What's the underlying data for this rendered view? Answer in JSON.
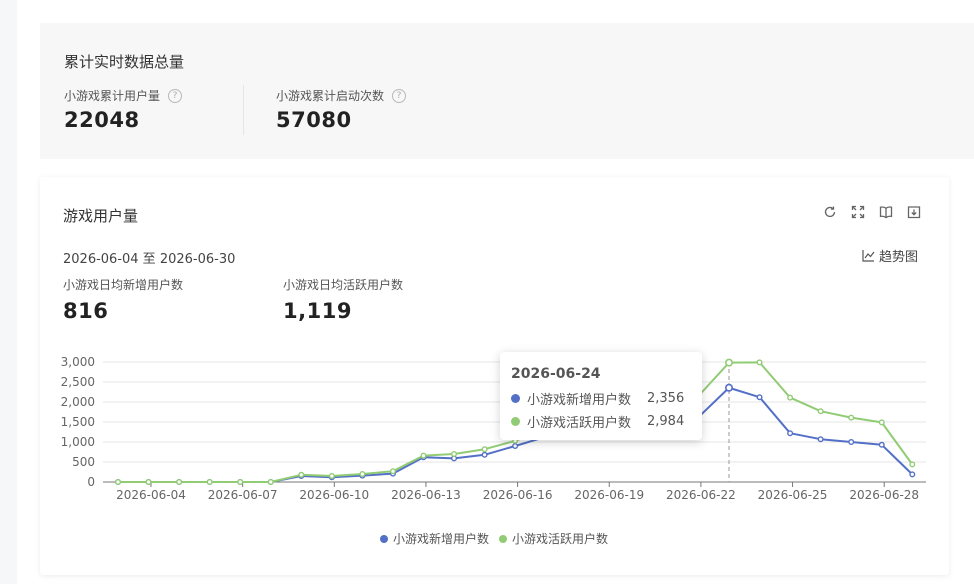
{
  "summary": {
    "title": "累计实时数据总量",
    "metrics": [
      {
        "label": "小游戏累计用户量",
        "value": "22048"
      },
      {
        "label": "小游戏累计启动次数",
        "value": "57080"
      }
    ]
  },
  "card": {
    "title": "游戏用户量",
    "date_range": "2026-06-04 至 2026-06-30",
    "trend_label": "趋势图",
    "toolbar_icons": [
      "refresh-icon",
      "fullscreen-icon",
      "book-icon",
      "download-icon"
    ],
    "kpis": [
      {
        "label": "小游戏日均新增用户数",
        "value": "816"
      },
      {
        "label": "小游戏日均活跃用户数",
        "value": "1,119"
      }
    ]
  },
  "tooltip": {
    "date": "2026-06-24",
    "rows": [
      {
        "label": "小游戏新增用户数",
        "value": "2,356"
      },
      {
        "label": "小游戏活跃用户数",
        "value": "2,984"
      }
    ]
  },
  "colors": {
    "new_users": "#5470c6",
    "active_users": "#91cc75"
  },
  "chart_data": {
    "type": "line",
    "x": [
      "2026-06-04",
      "2026-06-05",
      "2026-06-06",
      "2026-06-07",
      "2026-06-08",
      "2026-06-09",
      "2026-06-10",
      "2026-06-11",
      "2026-06-12",
      "2026-06-13",
      "2026-06-14",
      "2026-06-15",
      "2026-06-16",
      "2026-06-17",
      "2026-06-18",
      "2026-06-19",
      "2026-06-20",
      "2026-06-21",
      "2026-06-22",
      "2026-06-23",
      "2026-06-24",
      "2026-06-25",
      "2026-06-26",
      "2026-06-27",
      "2026-06-28",
      "2026-06-29",
      "2026-06-30"
    ],
    "x_tick_labels": [
      "2026-06-04",
      "2026-06-07",
      "2026-06-10",
      "2026-06-13",
      "2026-06-16",
      "2026-06-19",
      "2026-06-22",
      "2026-06-25",
      "2026-06-28"
    ],
    "y_ticks": [
      "0",
      "500",
      "1,000",
      "1,500",
      "2,000",
      "2,500",
      "3,000"
    ],
    "ylim": [
      0,
      3000
    ],
    "grid": true,
    "legend_position": "bottom",
    "series": [
      {
        "name": "小游戏新增用户数",
        "values": [
          0,
          0,
          0,
          0,
          0,
          0,
          150,
          120,
          160,
          210,
          620,
          590,
          680,
          900,
          1130,
          1300,
          1380,
          1450,
          1550,
          1620,
          2356,
          2120,
          1220,
          1070,
          1000,
          930,
          190
        ]
      },
      {
        "name": "小游戏活跃用户数",
        "values": [
          0,
          0,
          0,
          0,
          0,
          0,
          180,
          150,
          200,
          270,
          660,
          700,
          820,
          1030,
          1300,
          1500,
          1620,
          1700,
          1790,
          2150,
          2984,
          2990,
          2110,
          1770,
          1610,
          1490,
          440
        ]
      }
    ],
    "highlight_index": 20
  }
}
